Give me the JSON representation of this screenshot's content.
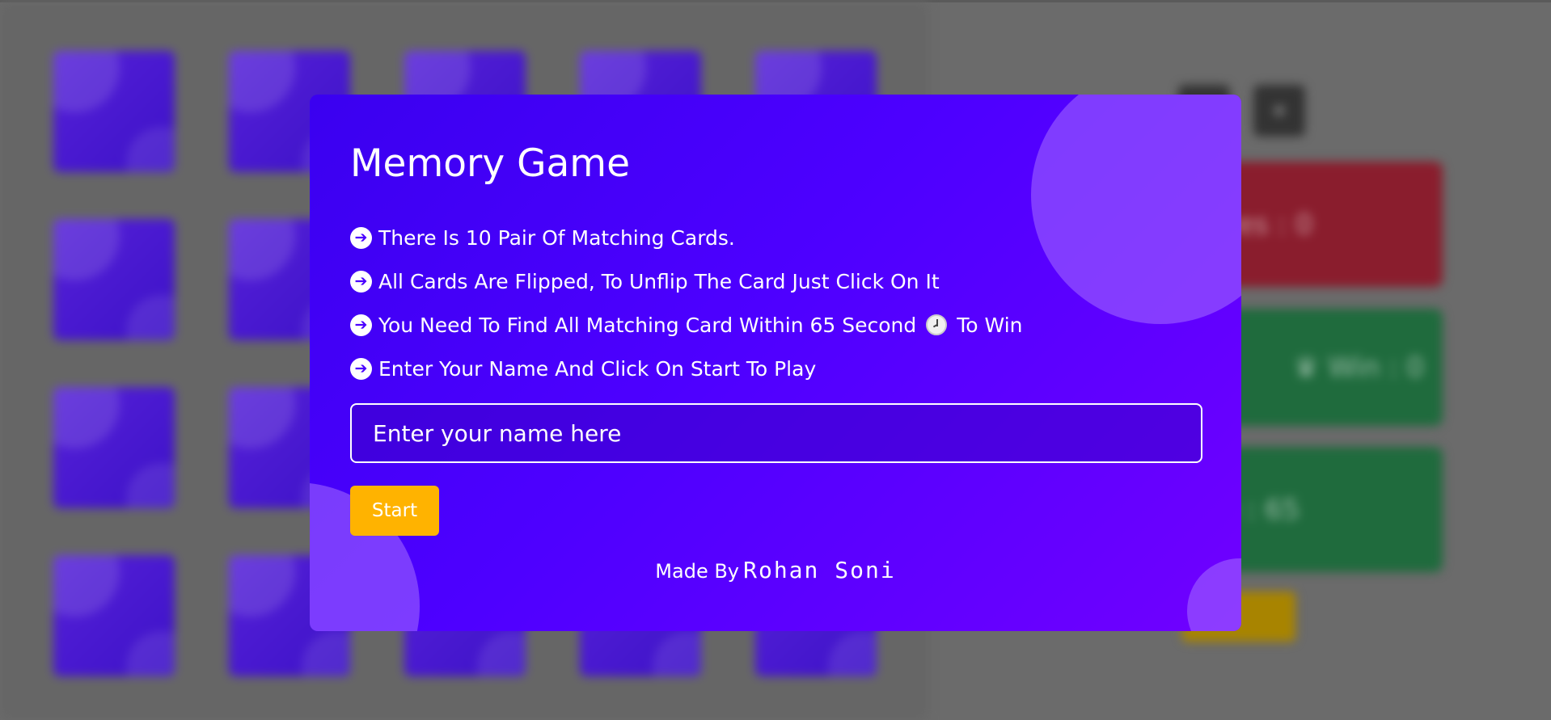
{
  "background": {
    "board_cards": 20,
    "controls": [
      {
        "icon": "pause-icon",
        "label": ""
      },
      {
        "icon": "add-icon",
        "label": "+"
      }
    ],
    "stats": {
      "moves": "ves : 0",
      "wins": "Win : 0",
      "time": "e : 65"
    }
  },
  "modal": {
    "title": "Memory Game",
    "rules": [
      "There Is 10 Pair Of Matching Cards.",
      "All Cards Are Flipped, To Unflip The Card Just Click On It",
      "You Need To Find All Matching Card Within 65 Second",
      "Enter Your Name And Click On Start To Play"
    ],
    "rule3_suffix": "To Win",
    "name_placeholder": "Enter your name here",
    "start_label": "Start",
    "credit_prefix": "Made By",
    "credit_name": "Rohan Soni"
  },
  "colors": {
    "modal_start": "#3a00f0",
    "modal_end": "#7000ff",
    "start_button": "#ffb300"
  }
}
